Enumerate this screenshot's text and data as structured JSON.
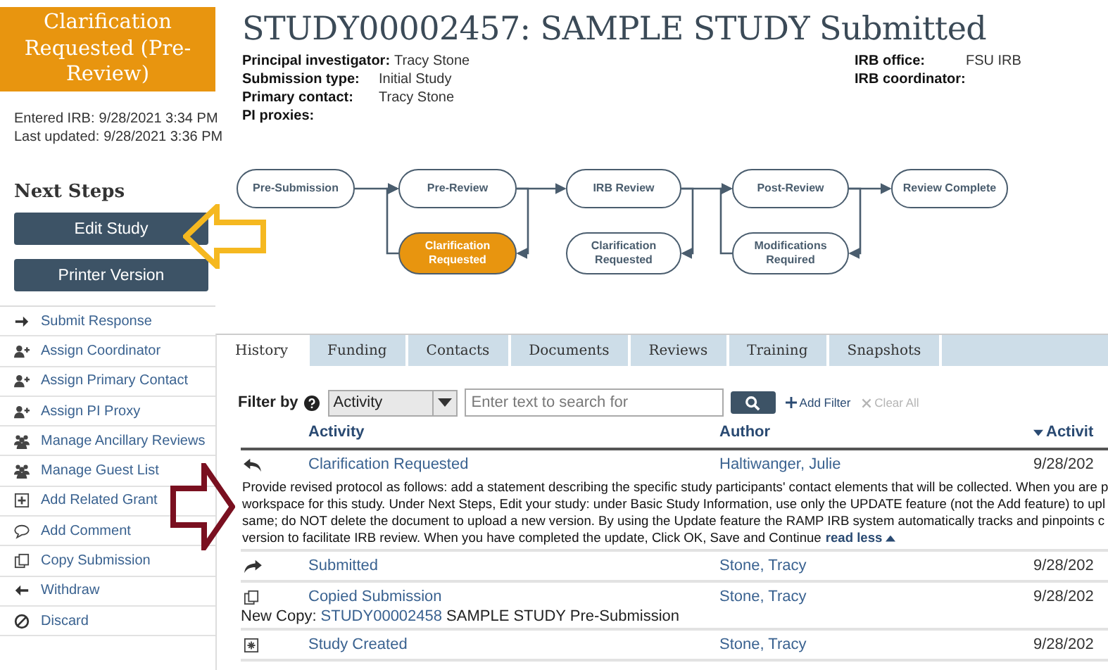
{
  "status_box": {
    "text": "Clarification Requested (Pre-Review)"
  },
  "dates": [
    {
      "label": "Entered IRB:",
      "value": "9/28/2021 3:34 PM"
    },
    {
      "label": "Last updated:",
      "value": "9/28/2021 3:36 PM"
    }
  ],
  "next_steps": {
    "heading": "Next Steps",
    "buttons": [
      "Edit Study",
      "Printer Version"
    ]
  },
  "actions": [
    {
      "kind": "submit",
      "label": "Submit Response"
    },
    {
      "kind": "assign",
      "label": "Assign Coordinator"
    },
    {
      "kind": "assign",
      "label": "Assign Primary Contact"
    },
    {
      "kind": "assign",
      "label": "Assign PI Proxy"
    },
    {
      "kind": "group",
      "label": "Manage Ancillary Reviews"
    },
    {
      "kind": "group",
      "label": "Manage Guest List"
    },
    {
      "kind": "grant",
      "label": "Add Related Grant"
    },
    {
      "kind": "comment",
      "label": "Add Comment"
    },
    {
      "kind": "copy",
      "label": "Copy Submission"
    },
    {
      "kind": "withdraw",
      "label": "Withdraw"
    },
    {
      "kind": "discard",
      "label": "Discard"
    }
  ],
  "header": {
    "title": "STUDY00002457: SAMPLE STUDY Submitted",
    "fields_left": [
      {
        "label": "Principal investigator:",
        "value": "Tracy Stone"
      },
      {
        "label": "Submission type:",
        "value": "Initial Study"
      },
      {
        "label": "Primary contact:",
        "value": "Tracy Stone"
      },
      {
        "label": "PI proxies:"
      }
    ],
    "fields_right": [
      {
        "label": "IRB office:",
        "value": "FSU IRB"
      },
      {
        "label": "IRB coordinator:"
      }
    ]
  },
  "workflow": {
    "nodes": [
      {
        "label": "Pre-Submission",
        "current": false
      },
      {
        "label": "Pre-Review",
        "current": false
      },
      {
        "label": "IRB Review",
        "current": false
      },
      {
        "label": "Post-Review",
        "current": false
      },
      {
        "label": "Review Complete",
        "current": false
      },
      {
        "label": "Clarification Requested",
        "current": true
      },
      {
        "label": "Clarification Requested",
        "current": false
      },
      {
        "label": "Modifications Required",
        "current": false
      }
    ]
  },
  "tabs": [
    {
      "label": "History",
      "selected": true
    },
    {
      "label": "Funding",
      "selected": false
    },
    {
      "label": "Contacts",
      "selected": false
    },
    {
      "label": "Documents",
      "selected": false
    },
    {
      "label": "Reviews",
      "selected": false
    },
    {
      "label": "Training",
      "selected": false
    },
    {
      "label": "Snapshots",
      "selected": false
    }
  ],
  "filter": {
    "label": "Filter by",
    "select": "Activity",
    "placeholder": "Enter text to search for",
    "add_filter": "Add Filter",
    "clear_all": "Clear All",
    "clear_disabled": true
  },
  "table": {
    "columns": [
      {
        "label": "Activity",
        "sorted": false
      },
      {
        "label": "Author",
        "sorted": false
      },
      {
        "label": "Activit",
        "sorted": true
      }
    ],
    "rows": [
      {
        "kind": "reply",
        "activity": "Clarification Requested",
        "author": "Haltiwanger, Julie",
        "date": "9/28/202",
        "note": {
          "lines": [
            "Provide revised protocol as follows: add a statement describing the specific study participants' contact elements that will be collected. When you are p",
            "workspace for this study. Under Next Steps, Edit your study: under Basic Study Information, use only the UPDATE feature (not the Add feature) to upl",
            "same; do NOT delete the document to upload a new version. By using the Update feature the RAMP IRB system automatically tracks and pinpoints c",
            "version to facilitate IRB review. When you have completed the update, Click OK, Save and Continue"
          ],
          "link": "read less"
        }
      },
      {
        "kind": "forward",
        "activity": "Submitted",
        "author": "Stone, Tracy",
        "date": "9/28/202"
      },
      {
        "kind": "copy",
        "activity": "Copied Submission",
        "author": "Stone, Tracy",
        "date": "9/28/202",
        "copy": {
          "label": "New Copy:",
          "link": "STUDY00002458",
          "text": "SAMPLE STUDY Pre-Submission"
        }
      },
      {
        "kind": "created",
        "activity": "Study Created",
        "author": "Stone, Tracy",
        "date": "9/28/202"
      }
    ]
  }
}
